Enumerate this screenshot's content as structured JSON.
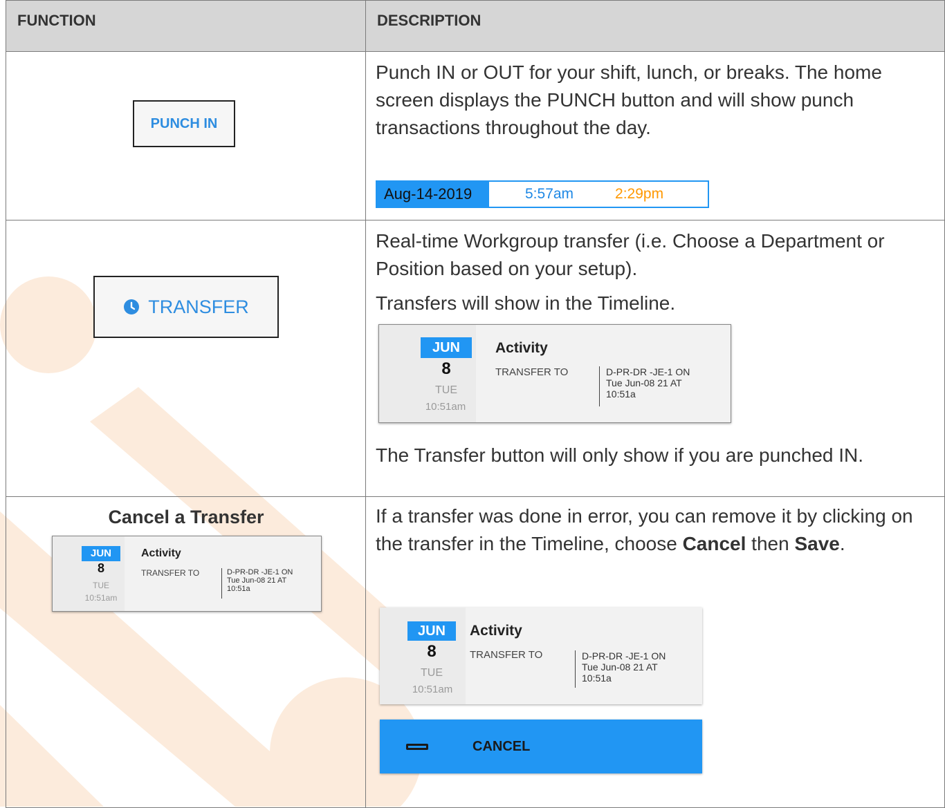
{
  "headers": {
    "function": "FUNCTION",
    "description": "DESCRIPTION"
  },
  "rows": [
    {
      "function_button": "PUNCH IN",
      "description": "Punch IN or OUT for your shift, lunch, or breaks. The home screen displays the PUNCH button and will show punch transactions throughout the day.",
      "punch_line": {
        "date": "Aug-14-2019",
        "time_in": "5:57am",
        "time_out": "2:29pm"
      }
    },
    {
      "function_button": "TRANSFER",
      "description_1": "Real-time Workgroup transfer (i.e. Choose a Department or Position based on your setup).",
      "description_2": "Transfers will show in the Timeline.",
      "description_3": "The Transfer button will only show if you are punched IN."
    },
    {
      "function_title": "Cancel a Transfer",
      "description_parts": {
        "p1": "If a transfer was done in error, you can remove it by clicking on the transfer in the Timeline, choose ",
        "cancel_word": "Cancel",
        "p2": " then ",
        "save_word": "Save",
        "p3": "."
      },
      "cancel_button": "CANCEL"
    }
  ],
  "timeline_card": {
    "month": "JUN",
    "day": "8",
    "weekday": "TUE",
    "time": "10:51am",
    "activity": "Activity",
    "label": "TRANSFER TO",
    "value_line1": "D-PR-DR -JE-1 ON",
    "value_line2": "Tue Jun-08 21 AT",
    "value_line3": "10:51a"
  },
  "icons": {
    "transfer": "clock-icon",
    "cancel": "minus-icon"
  },
  "colors": {
    "accent_blue": "#2196f3",
    "out_orange": "#ff9800",
    "header_gray": "#d6d6d6",
    "watermark": "#fbe6d2"
  }
}
